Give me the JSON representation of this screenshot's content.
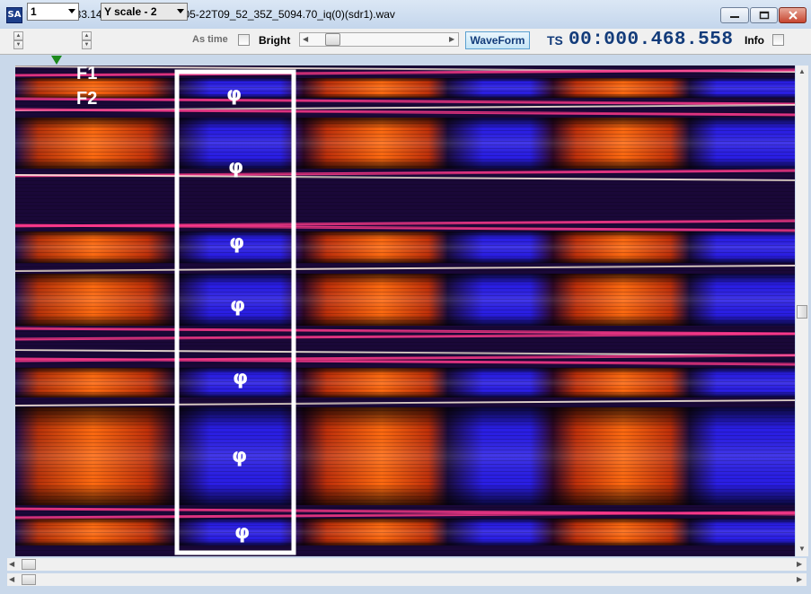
{
  "window": {
    "app_icon_text": "SA",
    "title": "[TempDir] 83.144.108.198_2020-05-22T09_52_35Z_5094.70_iq(0)(sdr1).wav"
  },
  "toolbar": {
    "channel_value": "1",
    "yscale_value": "Y scale - 2",
    "as_time_label": "As time",
    "bright_label": "Bright",
    "waveform_label": "WaveForm",
    "ts_label": "TS",
    "timestamp": "00:000.468.558",
    "info_label": "Info"
  },
  "plot": {
    "labels": {
      "f1": "F1",
      "f2": "F2"
    },
    "phi_symbol": "φ",
    "colors": {
      "warm": "#ff6a10",
      "cool": "#2a1ee6",
      "highlight_box": "#ffffff",
      "stripe": "#ff3a8c"
    }
  },
  "icons": {
    "minimize": "minimize-icon",
    "maximize": "maximize-icon",
    "close": "close-icon",
    "marker": "position-marker-icon"
  }
}
